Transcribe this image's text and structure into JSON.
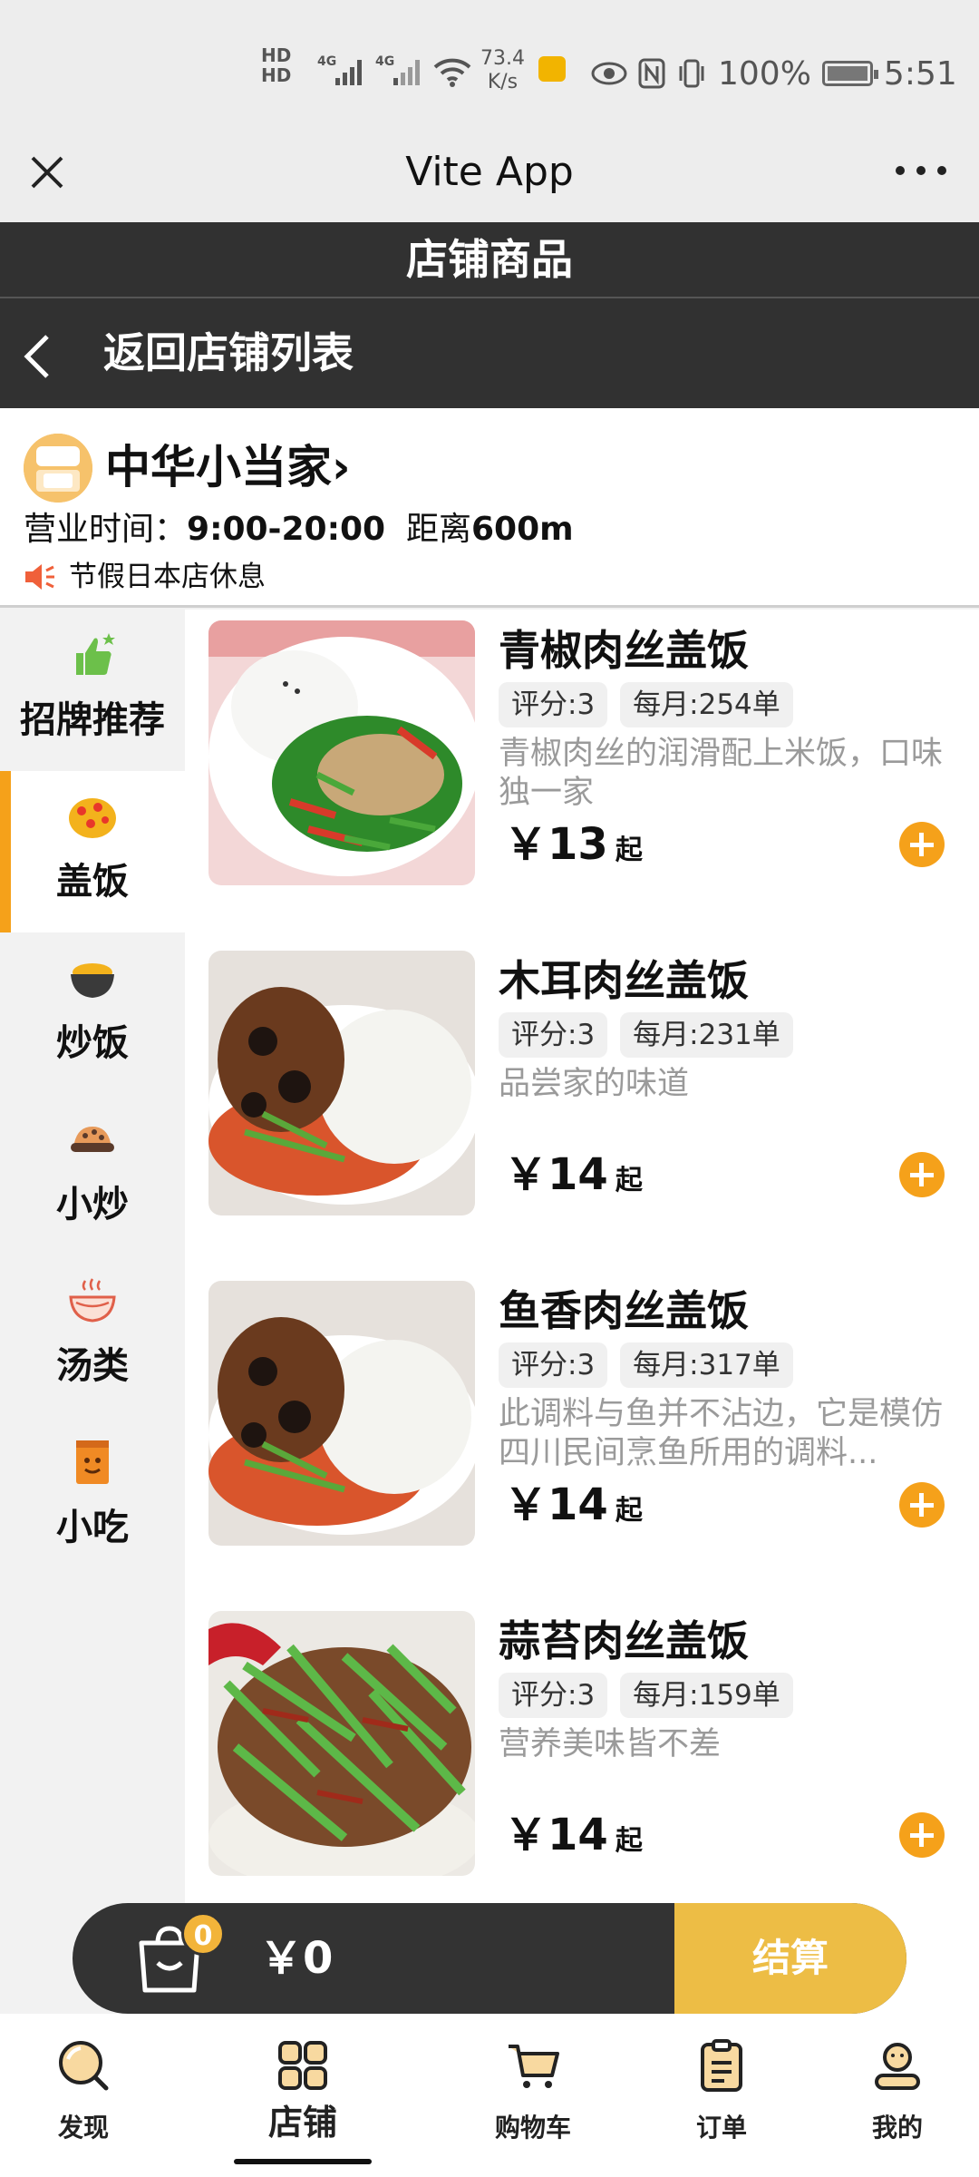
{
  "status_bar": {
    "network": "HD",
    "speed_value": "73.4",
    "speed_unit": "K/s",
    "battery": "100%",
    "time": "5:51"
  },
  "app": {
    "title": "Vite App"
  },
  "page": {
    "title": "店铺商品",
    "back_label": "返回店铺列表"
  },
  "store": {
    "name": "中华小当家",
    "hours_label": "营业时间：",
    "hours_value": "9:00-20:00",
    "distance_label": "距离",
    "distance_value": "600m",
    "notice": "节假日本店休息"
  },
  "categories": [
    {
      "label": "招牌推荐",
      "icon": "thumbs-up-icon"
    },
    {
      "label": "盖饭",
      "icon": "rice-bowl-icon"
    },
    {
      "label": "炒饭",
      "icon": "fried-rice-icon"
    },
    {
      "label": "小炒",
      "icon": "stir-fry-icon"
    },
    {
      "label": "汤类",
      "icon": "soup-icon"
    },
    {
      "label": "小吃",
      "icon": "snack-icon"
    }
  ],
  "active_category": 1,
  "items": [
    {
      "name": "青椒肉丝盖饭",
      "rating": "评分:3",
      "monthly": "每月:254单",
      "desc": "青椒肉丝的润滑配上米饭，口味独一家",
      "price": "￥13",
      "from": "起"
    },
    {
      "name": "木耳肉丝盖饭",
      "rating": "评分:3",
      "monthly": "每月:231单",
      "desc": "品尝家的味道",
      "price": "￥14",
      "from": "起"
    },
    {
      "name": "鱼香肉丝盖饭",
      "rating": "评分:3",
      "monthly": "每月:317单",
      "desc": "此调料与鱼并不沾边，它是模仿四川民间烹鱼所用的调料...",
      "price": "￥14",
      "from": "起"
    },
    {
      "name": "蒜苔肉丝盖饭",
      "rating": "评分:3",
      "monthly": "每月:159单",
      "desc": "营养美味皆不差",
      "price": "￥14",
      "from": "起"
    }
  ],
  "cart": {
    "count": "0",
    "total": "￥0",
    "checkout_label": "结算"
  },
  "tabs": [
    {
      "label": "发现",
      "icon": "discover-icon"
    },
    {
      "label": "店铺",
      "icon": "store-grid-icon"
    },
    {
      "label": "购物车",
      "icon": "cart-icon"
    },
    {
      "label": "订单",
      "icon": "order-icon"
    },
    {
      "label": "我的",
      "icon": "profile-icon"
    }
  ],
  "active_tab": 1,
  "colors": {
    "accent": "#f5a11a",
    "header_dark": "#313131",
    "checkout": "#edbd45"
  }
}
